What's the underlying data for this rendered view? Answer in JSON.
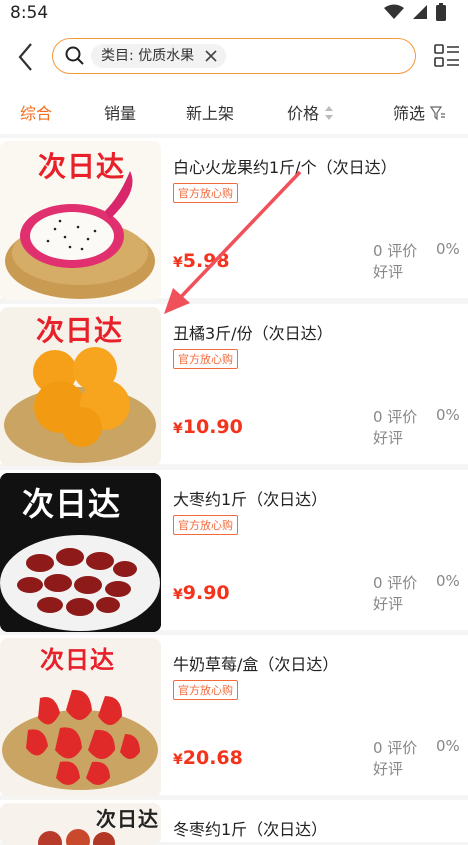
{
  "status": {
    "time": "8:54"
  },
  "search": {
    "chip_label": "类目: 优质水果"
  },
  "tabs": [
    "综合",
    "销量",
    "新上架",
    "价格",
    "筛选"
  ],
  "products": [
    {
      "title": "白心火龙果约1斤/个（次日达）",
      "badge": "官方放心购",
      "price": "5.98",
      "reviews": "0 评价",
      "rate": "0%",
      "rate_label": "好评",
      "image_tag": "次日达"
    },
    {
      "title": "丑橘3斤/份（次日达）",
      "badge": "官方放心购",
      "price": "10.90",
      "reviews": "0 评价",
      "rate": "0%",
      "rate_label": "好评",
      "image_tag": "次日达"
    },
    {
      "title": "大枣约1斤（次日达）",
      "badge": "官方放心购",
      "price": "9.90",
      "reviews": "0 评价",
      "rate": "0%",
      "rate_label": "好评",
      "image_tag": "次日达"
    },
    {
      "title": "牛奶草莓/盒（次日达）",
      "badge": "官方放心购",
      "price": "20.68",
      "reviews": "0 评价",
      "rate": "0%",
      "rate_label": "好评",
      "image_tag": "次日达"
    },
    {
      "title": "冬枣约1斤（次日达）",
      "image_tag": "次日达"
    }
  ],
  "colors": {
    "accent": "#f56d1f",
    "price": "#f4331c",
    "search_border": "#f39a3b"
  }
}
